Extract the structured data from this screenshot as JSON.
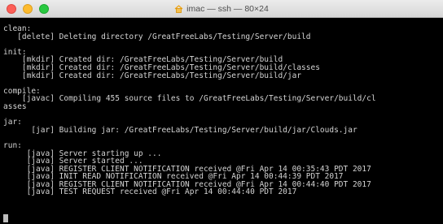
{
  "window": {
    "title": "imac — ssh — 80×24",
    "icon": "home-icon"
  },
  "terminal": {
    "lines": [
      "clean:",
      "   [delete] Deleting directory /GreatFreeLabs/Testing/Server/build",
      "",
      "init:",
      "    [mkdir] Created dir: /GreatFreeLabs/Testing/Server/build",
      "    [mkdir] Created dir: /GreatFreeLabs/Testing/Server/build/classes",
      "    [mkdir] Created dir: /GreatFreeLabs/Testing/Server/build/jar",
      "",
      "compile:",
      "    [javac] Compiling 455 source files to /GreatFreeLabs/Testing/Server/build/cl",
      "asses",
      "",
      "jar:",
      "      [jar] Building jar: /GreatFreeLabs/Testing/Server/build/jar/Clouds.jar",
      "",
      "run:",
      "     [java] Server starting up ...",
      "     [java] Server started ...",
      "     [java] REGISTER CLIENT NOTIFICATION received @Fri Apr 14 00:35:43 PDT 2017",
      "     [java] INIT READ NOTIFICATION received @Fri Apr 14 00:44:39 PDT 2017",
      "     [java] REGISTER CLIENT NOTIFICATION received @Fri Apr 14 00:44:40 PDT 2017",
      "     [java] TEST REQUEST received @Fri Apr 14 00:44:40 PDT 2017"
    ]
  }
}
